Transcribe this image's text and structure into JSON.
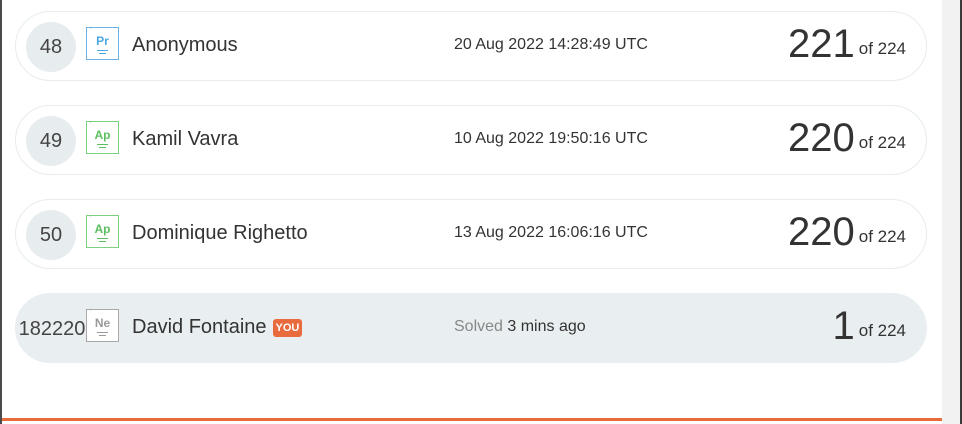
{
  "leaderboard": {
    "rows": [
      {
        "rank": "48",
        "element": {
          "symbol": "Pr",
          "number": "'",
          "color": "#4aa8e0"
        },
        "name": "Anonymous",
        "time": "20 Aug 2022 14:28:49 UTC",
        "score": "221",
        "of_label": "of 224"
      },
      {
        "rank": "49",
        "element": {
          "symbol": "Ap",
          "number": "'",
          "color": "#5cbf5f"
        },
        "name": "Kamil Vavra",
        "time": "10 Aug 2022 19:50:16 UTC",
        "score": "220",
        "of_label": "of 224"
      },
      {
        "rank": "50",
        "element": {
          "symbol": "Ap",
          "number": "'",
          "color": "#5cbf5f"
        },
        "name": "Dominique Righetto",
        "time": "13 Aug 2022 16:06:16 UTC",
        "score": "220",
        "of_label": "of 224"
      }
    ],
    "current_user": {
      "rank": "182220",
      "element": {
        "symbol": "Ne",
        "number": "'",
        "color": "#9a9a9a"
      },
      "name": "David Fontaine",
      "badge": "YOU",
      "solved_label": "Solved",
      "solved_time": "3 mins ago",
      "score": "1",
      "of_label": "of 224"
    }
  },
  "colors": {
    "accent": "#e96b3d",
    "row_border": "#e6ecef",
    "highlight_row": "#e9eef1"
  }
}
